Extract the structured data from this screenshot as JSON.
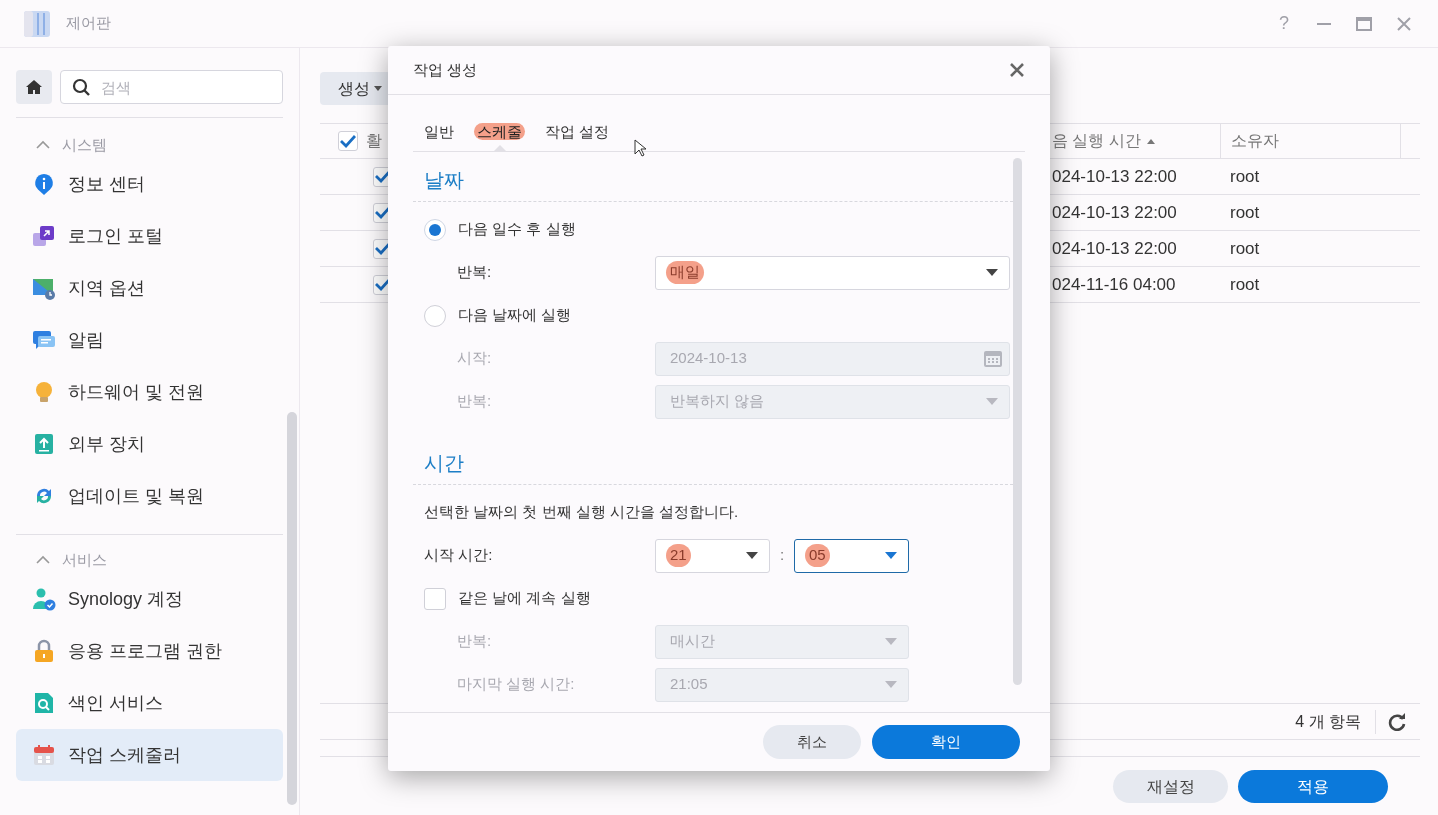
{
  "window": {
    "title": "제어판",
    "help": "?"
  },
  "sidebar": {
    "search": {
      "placeholder": "검색"
    },
    "sections": [
      {
        "title": "시스템",
        "expanded": true,
        "items": [
          {
            "label": "정보 센터",
            "kind": "info",
            "selected": false
          },
          {
            "label": "로그인 포털",
            "kind": "portal",
            "selected": false
          },
          {
            "label": "지역 옵션",
            "kind": "region",
            "selected": false
          },
          {
            "label": "알림",
            "kind": "notification",
            "selected": false
          },
          {
            "label": "하드웨어 및 전원",
            "kind": "hardware",
            "selected": false
          },
          {
            "label": "외부 장치",
            "kind": "external",
            "selected": false
          },
          {
            "label": "업데이트 및 복원",
            "kind": "update",
            "selected": false
          }
        ]
      },
      {
        "title": "서비스",
        "expanded": true,
        "items": [
          {
            "label": "Synology 계정",
            "kind": "account",
            "selected": false
          },
          {
            "label": "응용 프로그램 권한",
            "kind": "permission",
            "selected": false
          },
          {
            "label": "색인 서비스",
            "kind": "index",
            "selected": false
          },
          {
            "label": "작업 스케줄러",
            "kind": "scheduler",
            "selected": true
          }
        ]
      }
    ]
  },
  "toolbar": {
    "create_button": "생성"
  },
  "table": {
    "header_checked": true,
    "columns": [
      {
        "label": "활"
      },
      {
        "label": "음 실행 시간",
        "sort_ascending": true
      },
      {
        "label": "소유자"
      }
    ],
    "rows": [
      {
        "checked": true,
        "column_2": "024-10-13 22:00",
        "owner": "root"
      },
      {
        "checked": true,
        "column_2": "024-10-13 22:00",
        "owner": "root"
      },
      {
        "checked": true,
        "column_2": "024-10-13 22:00",
        "owner": "root"
      },
      {
        "checked": true,
        "column_2": "024-11-16 04:00",
        "owner": "root"
      }
    ],
    "count": "4 개 항목"
  },
  "footer_buttons": [
    {
      "label": "재설정",
      "primary": false
    },
    {
      "label": "적용",
      "primary": true
    }
  ],
  "dialog": {
    "title": "작업 생성",
    "tabs": [
      {
        "label": "일반",
        "selected": false,
        "highlighted": false
      },
      {
        "label": "스케줄",
        "selected": true,
        "highlighted": true
      },
      {
        "label": "작업 설정",
        "selected": false,
        "highlighted": false
      }
    ],
    "sections": [
      {
        "title": "날짜",
        "rows": [
          {
            "kind": "radio",
            "label": "다음 일수 후 실행",
            "selected": true
          },
          {
            "kind": "select",
            "label": "반복:",
            "value": "매일",
            "disabled": false,
            "highlighted": true
          },
          {
            "kind": "radio",
            "label": "다음 날짜에 실행",
            "selected": false
          },
          {
            "kind": "date",
            "label": "시작:",
            "value": "2024-10-13",
            "disabled": true
          },
          {
            "kind": "select",
            "label": "반복:",
            "value": "반복하지 않음",
            "disabled": true,
            "highlighted": false
          }
        ]
      },
      {
        "title": "시간",
        "rows": [
          {
            "kind": "text",
            "text": "선택한 날짜의 첫 번째 실행 시간을 설정합니다."
          },
          {
            "kind": "time",
            "label": "시작 시간:",
            "separator": ":",
            "hour": {
              "value": "21",
              "highlighted": true,
              "focused": false
            },
            "minute": {
              "value": "05",
              "highlighted": true,
              "focused": true
            }
          },
          {
            "kind": "checkbox",
            "label": "같은 날에 계속 실행",
            "checked": false
          },
          {
            "kind": "short_select",
            "label": "반복:",
            "value": "매시간",
            "disabled": true,
            "highlighted": false
          },
          {
            "kind": "short_select",
            "label": "마지막 실행 시간:",
            "value": "21:05",
            "disabled": true,
            "highlighted": false
          }
        ]
      }
    ],
    "buttons": [
      {
        "label": "취소",
        "primary": false
      },
      {
        "label": "확인",
        "primary": true
      }
    ]
  }
}
